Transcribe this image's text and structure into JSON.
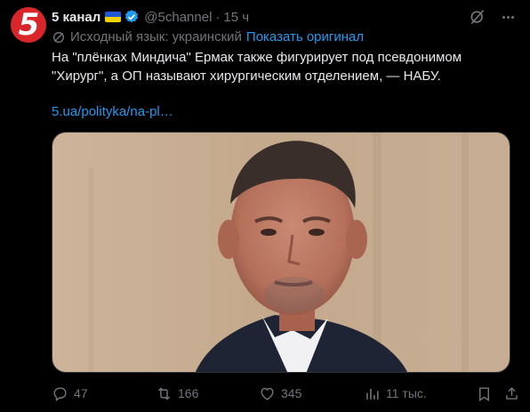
{
  "author": {
    "name": "5 канал",
    "handle": "@5channel",
    "separator": "·",
    "time": "15 ч",
    "avatar_glyph": "5",
    "avatar_color": "#d9262b",
    "verified_color": "#1d9bf0"
  },
  "translation": {
    "source_language": "Исходный язык: украинский",
    "show_original": "Показать оригинал"
  },
  "post": {
    "text_line1": "На \"плёнках Миндича\" Ермак также фигурирует под псевдонимом",
    "text_line2": "\"Хирург\", а ОП называют хирургическим отделением, — НАБУ.",
    "link": "5.ua/polityka/na-pl…"
  },
  "actions": {
    "replies": "47",
    "reposts": "166",
    "likes": "345",
    "views": "11 тыс."
  },
  "icons": {
    "avatar": "channel-5-logo",
    "verified": "verified-badge-icon",
    "grok": "grok-icon",
    "more": "more-icon",
    "translate": "translate-icon",
    "reply": "reply-icon",
    "repost": "repost-icon",
    "like": "heart-icon",
    "views": "views-icon",
    "bookmark": "bookmark-icon",
    "share": "share-icon"
  },
  "colors": {
    "background": "#000000",
    "text": "#e7e9ea",
    "secondary": "#71767b",
    "link": "#1d9bf0"
  }
}
